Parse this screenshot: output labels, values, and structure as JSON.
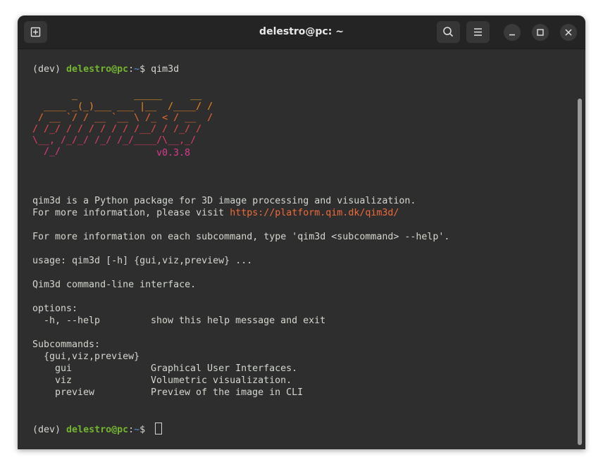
{
  "window": {
    "title": "delestro@pc: ~"
  },
  "prompt1": {
    "env": "(dev) ",
    "user_host": "delestro@pc",
    "colon": ":",
    "path": "~",
    "symbol": "$ ",
    "command": "qim3d"
  },
  "logo": {
    "art": [
      "       _          _____     __",
      "  ____ _(_)___ ___ |__  /____/ /",
      " / __ `/ / __ `__ \\ /_ < / __  /",
      "/ /_/ / / / / / / /__/ / /_/ /",
      "\\__, /_/_/ /_/ /_/____/\\__,_/",
      "  /_/"
    ],
    "colors": [
      "#f5a623",
      "#f18a1f",
      "#ee6a2c",
      "#e84a45",
      "#e23a68",
      "#db3a8e"
    ],
    "version": "v0.3.8",
    "version_color": "#db3a8e"
  },
  "info": {
    "line1": "qim3d is a Python package for 3D image processing and visualization.",
    "line2_prefix": "For more information, please visit ",
    "link": "https://platform.qim.dk/qim3d/",
    "line3": "For more information on each subcommand, type 'qim3d <subcommand> --help'."
  },
  "help": {
    "usage": "usage: qim3d [-h] {gui,viz,preview} ...",
    "description": "Qim3d command-line interface.",
    "options_header": "options:",
    "option_h_flag": "  -h, --help",
    "option_h_desc": "show this help message and exit",
    "subcommands_header": "Subcommands:",
    "subcommands_group": "  {gui,viz,preview}",
    "subcommands": [
      {
        "name": "    gui",
        "desc": "Graphical User Interfaces."
      },
      {
        "name": "    viz",
        "desc": "Volumetric visualization."
      },
      {
        "name": "    preview",
        "desc": "Preview of the image in CLI"
      }
    ]
  },
  "prompt2": {
    "env": "(dev) ",
    "user_host": "delestro@pc",
    "colon": ":",
    "path": "~",
    "symbol": "$ "
  }
}
